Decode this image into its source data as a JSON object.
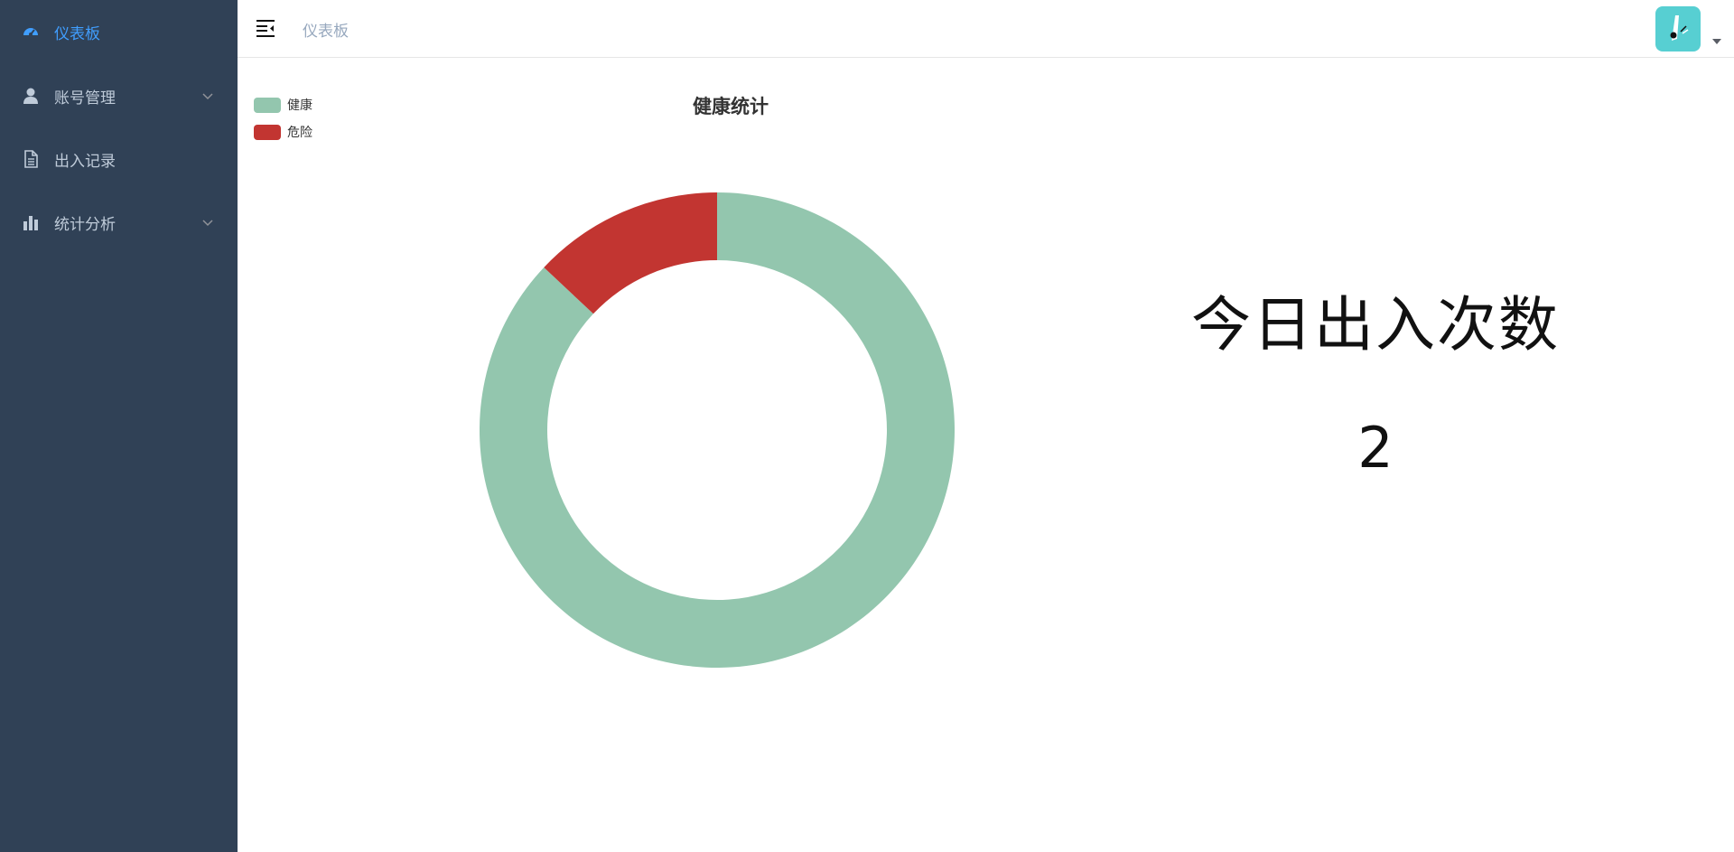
{
  "sidebar": {
    "bg_color": "#304156",
    "active_color": "#409eff",
    "text_color": "#bfcbd9",
    "items": [
      {
        "label": "仪表板",
        "icon": "dashboard-icon",
        "active": true,
        "has_submenu": false
      },
      {
        "label": "账号管理",
        "icon": "user-icon",
        "active": false,
        "has_submenu": true
      },
      {
        "label": "出入记录",
        "icon": "document-icon",
        "active": false,
        "has_submenu": false
      },
      {
        "label": "统计分析",
        "icon": "bar-chart-icon",
        "active": false,
        "has_submenu": true
      }
    ]
  },
  "navbar": {
    "breadcrumb": "仪表板",
    "hamburger_icon": "menu-fold-icon",
    "avatar_icon": "avatar-icon",
    "avatar_color": "#57cfd2"
  },
  "chart_data": {
    "type": "pie",
    "title": "健康统计",
    "legend_position": "top-left",
    "donut": true,
    "series": [
      {
        "name": "健康",
        "value": 87,
        "color": "#93c6ae"
      },
      {
        "name": "危险",
        "value": 13,
        "color": "#c23531"
      }
    ]
  },
  "stat": {
    "title": "今日出入次数",
    "value": "2"
  }
}
